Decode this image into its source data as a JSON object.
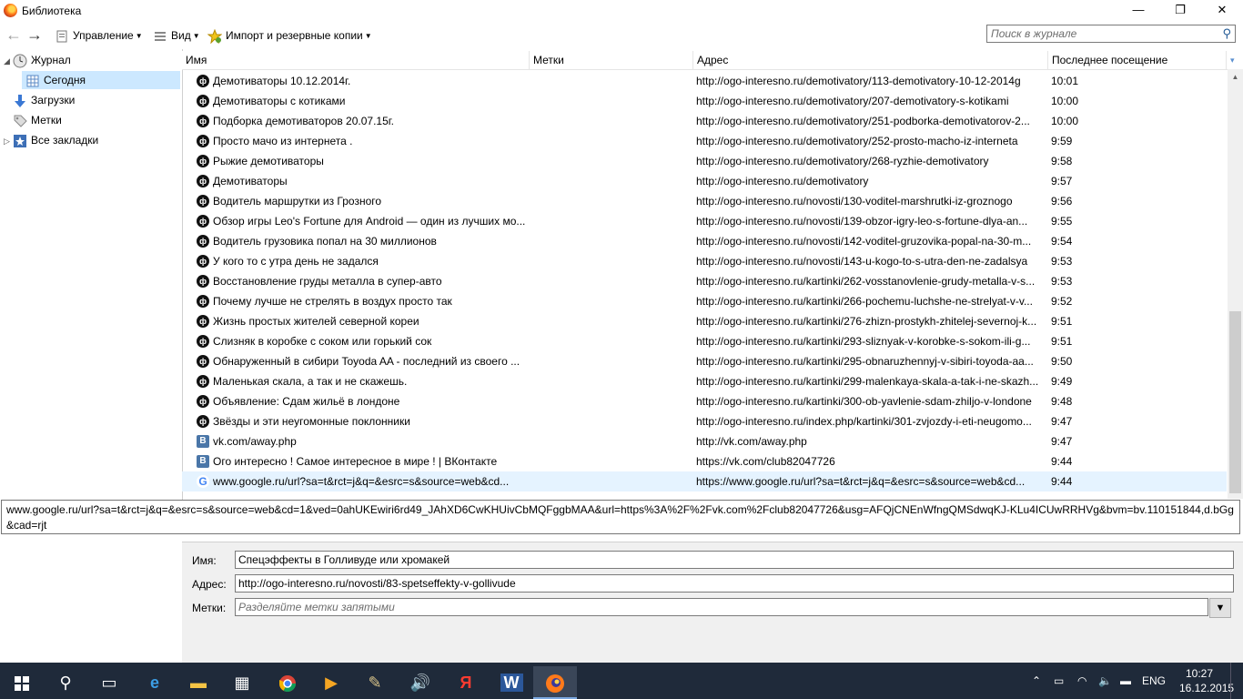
{
  "window": {
    "title": "Библиотека",
    "minimize": "—",
    "maximize": "❐",
    "close": "✕"
  },
  "toolbar": {
    "back": "←",
    "forward": "→",
    "manage_label": "Управление",
    "view_label": "Вид",
    "import_label": "Импорт и резервные копии",
    "search_placeholder": "Поиск в журнале"
  },
  "sidebar": {
    "items": [
      {
        "label": "Журнал"
      },
      {
        "label": "Сегодня"
      },
      {
        "label": "Загрузки"
      },
      {
        "label": "Метки"
      },
      {
        "label": "Все закладки"
      }
    ]
  },
  "table": {
    "columns": [
      "Имя",
      "Метки",
      "Адрес",
      "Последнее посещение"
    ],
    "rows": [
      {
        "icon": "ogo",
        "name": "Демотиваторы 10.12.2014г.",
        "url": "http://ogo-interesno.ru/demotivatory/113-demotivatory-10-12-2014g",
        "time": "10:01"
      },
      {
        "icon": "ogo",
        "name": "Демотиваторы с котиками",
        "url": "http://ogo-interesno.ru/demotivatory/207-demotivatory-s-kotikami",
        "time": "10:00"
      },
      {
        "icon": "ogo",
        "name": "Подборка демотиваторов 20.07.15г.",
        "url": "http://ogo-interesno.ru/demotivatory/251-podborka-demotivatorov-2...",
        "time": "10:00"
      },
      {
        "icon": "ogo",
        "name": "Просто мачо из интернета .",
        "url": "http://ogo-interesno.ru/demotivatory/252-prosto-macho-iz-interneta",
        "time": "9:59"
      },
      {
        "icon": "ogo",
        "name": "Рыжие демотиваторы",
        "url": "http://ogo-interesno.ru/demotivatory/268-ryzhie-demotivatory",
        "time": "9:58"
      },
      {
        "icon": "ogo",
        "name": "Демотиваторы",
        "url": "http://ogo-interesno.ru/demotivatory",
        "time": "9:57"
      },
      {
        "icon": "ogo",
        "name": "Водитель маршрутки из Грозного",
        "url": "http://ogo-interesno.ru/novosti/130-voditel-marshrutki-iz-groznogo",
        "time": "9:56"
      },
      {
        "icon": "ogo",
        "name": "Обзор игры Leo's Fortune для Android — один из лучших мо...",
        "url": "http://ogo-interesno.ru/novosti/139-obzor-igry-leo-s-fortune-dlya-an...",
        "time": "9:55"
      },
      {
        "icon": "ogo",
        "name": "Водитель грузовика попал на 30 миллионов",
        "url": "http://ogo-interesno.ru/novosti/142-voditel-gruzovika-popal-na-30-m...",
        "time": "9:54"
      },
      {
        "icon": "ogo",
        "name": "У кого то с утра день не задался",
        "url": "http://ogo-interesno.ru/novosti/143-u-kogo-to-s-utra-den-ne-zadalsya",
        "time": "9:53"
      },
      {
        "icon": "ogo",
        "name": "Восстановление груды металла в супер-авто",
        "url": "http://ogo-interesno.ru/kartinki/262-vosstanovlenie-grudy-metalla-v-s...",
        "time": "9:53"
      },
      {
        "icon": "ogo",
        "name": "Почему лучше не стрелять в воздух просто так",
        "url": "http://ogo-interesno.ru/kartinki/266-pochemu-luchshe-ne-strelyat-v-v...",
        "time": "9:52"
      },
      {
        "icon": "ogo",
        "name": "Жизнь простых жителей северной кореи",
        "url": "http://ogo-interesno.ru/kartinki/276-zhizn-prostykh-zhitelej-severnoj-k...",
        "time": "9:51"
      },
      {
        "icon": "ogo",
        "name": "Слизняк в коробке с соком или горький сок",
        "url": "http://ogo-interesno.ru/kartinki/293-sliznyak-v-korobke-s-sokom-ili-g...",
        "time": "9:51"
      },
      {
        "icon": "ogo",
        "name": "Обнаруженный в сибири Toyoda AA - последний из своего ...",
        "url": "http://ogo-interesno.ru/kartinki/295-obnaruzhennyj-v-sibiri-toyoda-aa...",
        "time": "9:50"
      },
      {
        "icon": "ogo",
        "name": "Маленькая скала, а так и не скажешь.",
        "url": "http://ogo-interesno.ru/kartinki/299-malenkaya-skala-a-tak-i-ne-skazh...",
        "time": "9:49"
      },
      {
        "icon": "ogo",
        "name": "Объявление: Сдам жильё в лондоне",
        "url": "http://ogo-interesno.ru/kartinki/300-ob-yavlenie-sdam-zhiljo-v-londone",
        "time": "9:48"
      },
      {
        "icon": "ogo",
        "name": "Звёзды и эти неугомонные поклонники",
        "url": "http://ogo-interesno.ru/index.php/kartinki/301-zvjozdy-i-eti-neugomo...",
        "time": "9:47"
      },
      {
        "icon": "vk",
        "name": "vk.com/away.php",
        "url": "http://vk.com/away.php",
        "time": "9:47"
      },
      {
        "icon": "vk",
        "name": "Ого интересно ! Самое интересное в мире ! | ВКонтакте",
        "url": "https://vk.com/club82047726",
        "time": "9:44"
      },
      {
        "icon": "google",
        "name": "www.google.ru/url?sa=t&rct=j&q=&esrc=s&source=web&cd...",
        "url": "https://www.google.ru/url?sa=t&rct=j&q=&esrc=s&source=web&cd...",
        "time": "9:44"
      }
    ]
  },
  "tooltip": {
    "text": "www.google.ru/url?sa=t&rct=j&q=&esrc=s&source=web&cd=1&ved=0ahUKEwiri6rd49_JAhXD6CwKHUivCbMQFggbMAA&url=https%3A%2F%2Fvk.com%2Fclub82047726&usg=AFQjCNEnWfngQMSdwqKJ-KLu4ICUwRRHVg&bvm=bv.110151844,d.bGg&cad=rjt"
  },
  "details": {
    "name_label": "Имя:",
    "name_value": "Спецэффекты в Голливуде или хромакей",
    "address_label": "Адрес:",
    "address_value": "http://ogo-interesno.ru/novosti/83-spetseffekty-v-gollivude",
    "tags_label": "Метки:",
    "tags_placeholder": "Разделяйте метки запятыми"
  },
  "taskbar": {
    "language": "ENG",
    "time": "10:27",
    "date": "16.12.2015"
  },
  "colors": {
    "selection": "#cce8ff",
    "hover": "#e5f3ff",
    "taskbar": "#1f2a3a"
  }
}
